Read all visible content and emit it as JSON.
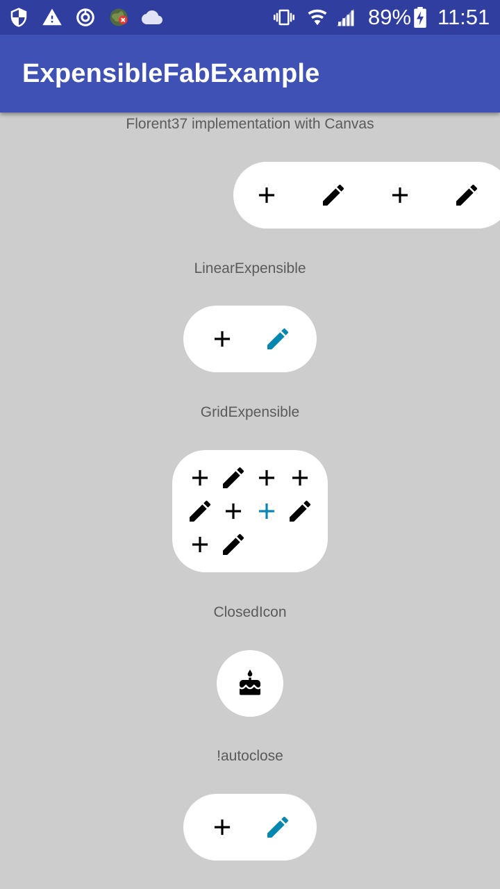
{
  "status_bar": {
    "battery_percent": "89%",
    "time": "11:51",
    "icons": [
      "shield-icon",
      "warning-icon",
      "sync-icon",
      "globe-error-icon",
      "cloud-icon",
      "vibrate-icon",
      "wifi-icon",
      "signal-icon",
      "battery-charging-icon"
    ]
  },
  "app_bar": {
    "title": "ExpensibleFabExample"
  },
  "sections": [
    {
      "label": "Florent37 implementation with Canvas",
      "buttons": [
        "plus-icon",
        "pencil-icon",
        "plus-icon",
        "pencil-icon"
      ]
    },
    {
      "label": "LinearExpensible",
      "buttons": [
        "plus-icon",
        "pencil-icon"
      ],
      "accent_button": 1
    },
    {
      "label": "GridExpensible",
      "buttons": [
        "plus-icon",
        "pencil-icon",
        "plus-icon",
        "plus-icon",
        "pencil-icon",
        "plus-icon",
        "plus-icon",
        "pencil-icon",
        "plus-icon",
        "pencil-icon"
      ],
      "accent_button": 6
    },
    {
      "label": "ClosedIcon",
      "buttons": [
        "cake-icon"
      ]
    },
    {
      "label": "!autoclose",
      "buttons": [
        "plus-icon",
        "pencil-icon"
      ],
      "accent_button": 1
    }
  ],
  "colors": {
    "status_bar": "#303f9f",
    "app_bar": "#3f51b5",
    "background": "#cdcdcd",
    "accent": "#0288b0",
    "icon": "#000000"
  }
}
